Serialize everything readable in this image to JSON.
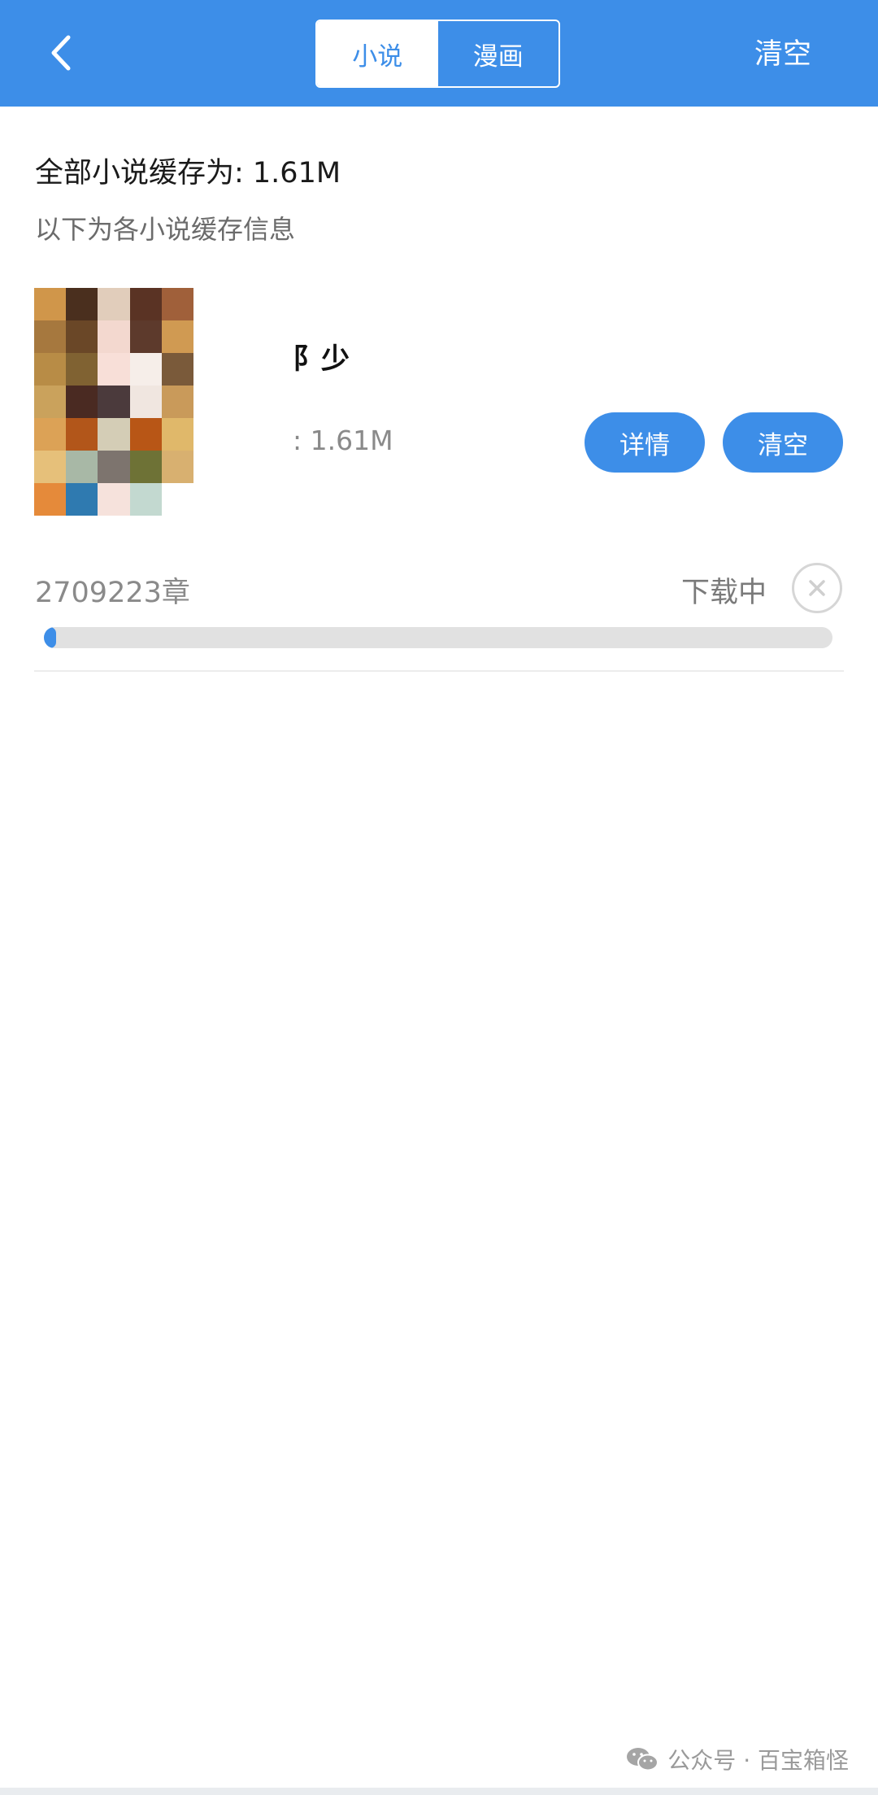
{
  "header": {
    "tabs": [
      {
        "label": "小说",
        "active": true
      },
      {
        "label": "漫画",
        "active": false
      }
    ],
    "clear_label": "清空",
    "accent_color": "#3d8ee8"
  },
  "summary": {
    "total_cache": "全部小说缓存为: 1.61M",
    "subtitle": "以下为各小说缓存信息"
  },
  "books": [
    {
      "title": "阝少",
      "cache_size": ": 1.61M",
      "detail_label": "详情",
      "clear_label": "清空",
      "chapters": "2709223章",
      "status": "下载中",
      "progress": 0.015
    }
  ],
  "watermark": {
    "text": "公众号 · 百宝箱怪",
    "icon": "wechat-icon"
  }
}
